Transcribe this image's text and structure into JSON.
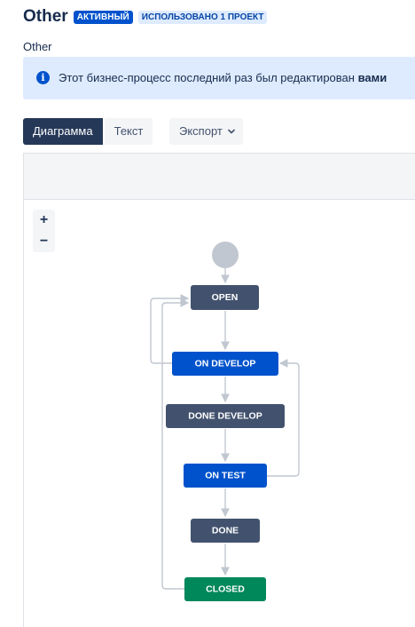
{
  "header": {
    "title": "Other",
    "status_lozenge": "АКТИВНЫЙ",
    "usage_lozenge": "ИСПОЛЬЗОВАНО 1 ПРОЕКТ"
  },
  "description": "Other",
  "info": {
    "icon": "info-icon",
    "text_prefix": "Этот бизнес-процесс последний раз был редактирован ",
    "text_bold": "вами"
  },
  "tabs": [
    {
      "label": "Диаграмма",
      "active": true
    },
    {
      "label": "Текст",
      "active": false
    }
  ],
  "export": {
    "label": "Экспорт",
    "icon": "chevron-down-icon"
  },
  "zoom": {
    "in_label": "+",
    "out_label": "−"
  },
  "colors": {
    "status_todo": "#42526e",
    "status_inprogress": "#0052cc",
    "status_done": "#00875a",
    "start_node": "#c1c7d0",
    "connector": "#c1c7d0"
  },
  "workflow": {
    "statuses": [
      {
        "id": "open",
        "label": "OPEN",
        "category": "todo"
      },
      {
        "id": "on_develop",
        "label": "ON DEVELOP",
        "category": "inprogress"
      },
      {
        "id": "done_develop",
        "label": "DONE DEVELOP",
        "category": "todo"
      },
      {
        "id": "on_test",
        "label": "ON TEST",
        "category": "inprogress"
      },
      {
        "id": "done",
        "label": "DONE",
        "category": "todo"
      },
      {
        "id": "closed",
        "label": "CLOSED",
        "category": "done"
      }
    ]
  }
}
